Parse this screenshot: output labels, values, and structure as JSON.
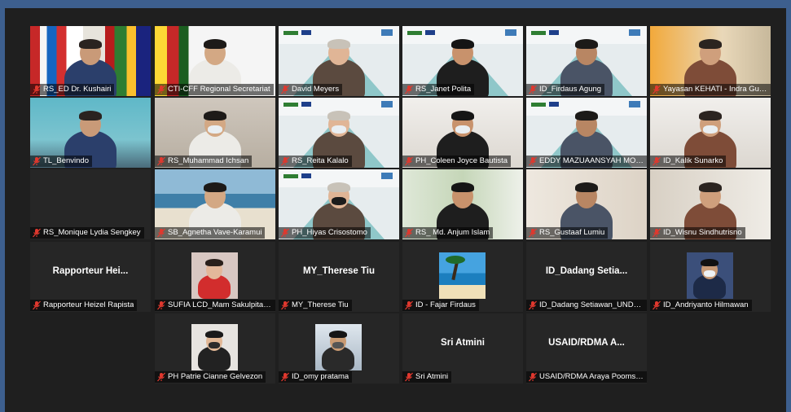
{
  "participants": [
    {
      "row": 0,
      "col": 0,
      "name": "RS_ED Dr. Kushairi",
      "type": "video",
      "bg": "flags"
    },
    {
      "row": 0,
      "col": 1,
      "name": "CTI-CFF Regional Secretariat",
      "type": "video",
      "bg": "flags2"
    },
    {
      "row": 0,
      "col": 2,
      "name": "David Meyers",
      "type": "video",
      "bg": "slide"
    },
    {
      "row": 0,
      "col": 3,
      "name": "RS_Janet Polita",
      "type": "video",
      "bg": "slide",
      "active": true
    },
    {
      "row": 0,
      "col": 4,
      "name": "ID_Firdaus Agung",
      "type": "video",
      "bg": "slide"
    },
    {
      "row": 0,
      "col": 5,
      "name": "Yayasan KEHATI - Indra Guna...",
      "type": "video",
      "bg": "warm"
    },
    {
      "row": 1,
      "col": 0,
      "name": "TL_Benvindo",
      "type": "video",
      "bg": "room"
    },
    {
      "row": 1,
      "col": 1,
      "name": "RS_Muhammad Ichsan",
      "type": "video",
      "bg": "wall"
    },
    {
      "row": 1,
      "col": 2,
      "name": "RS_Reita Kalalo",
      "type": "video",
      "bg": "slide"
    },
    {
      "row": 1,
      "col": 3,
      "name": "PH_Coleen Joyce Bautista",
      "type": "video",
      "bg": "light"
    },
    {
      "row": 1,
      "col": 4,
      "name": "EDDY MAZUAANSYAH MOHD...",
      "type": "video",
      "bg": "slide"
    },
    {
      "row": 1,
      "col": 5,
      "name": "ID_Kalik Sunarko",
      "type": "video",
      "bg": "light"
    },
    {
      "row": 2,
      "col": 0,
      "name": "RS_Monique Lydia Sengkey",
      "type": "blank"
    },
    {
      "row": 2,
      "col": 1,
      "name": "SB_Agnetha Vave-Karamui",
      "type": "video",
      "bg": "beach"
    },
    {
      "row": 2,
      "col": 2,
      "name": "PH_Hiyas Crisostomo",
      "type": "video",
      "bg": "slide"
    },
    {
      "row": 2,
      "col": 3,
      "name": "RS_ Md. Anjum Islam",
      "type": "video",
      "bg": "leaf"
    },
    {
      "row": 2,
      "col": 4,
      "name": "RS_Gustaaf Lumiu",
      "type": "video",
      "bg": "office"
    },
    {
      "row": 2,
      "col": 5,
      "name": "ID_Wisnu Sindhutrisno",
      "type": "video",
      "bg": "office2"
    },
    {
      "row": 3,
      "col": 0,
      "name": "Rapporteur Heizel Rapista",
      "type": "text",
      "display": "Rapporteur  Hei..."
    },
    {
      "row": 3,
      "col": 1,
      "name": "SUFIA LCD_Mam Sakulpitakph...",
      "type": "photo",
      "thumb": "woman-red"
    },
    {
      "row": 3,
      "col": 2,
      "name": "MY_Therese Tiu",
      "type": "text",
      "display": "MY_Therese Tiu"
    },
    {
      "row": 3,
      "col": 3,
      "name": "ID - Fajar Firdaus",
      "type": "photo",
      "thumb": "beach-photo"
    },
    {
      "row": 3,
      "col": 4,
      "name": "ID_Dadang Setiawan_UNDP A...",
      "type": "text",
      "display": "ID_Dadang  Setia..."
    },
    {
      "row": 3,
      "col": 5,
      "name": "ID_Andriyanto Hilmawan",
      "type": "photo",
      "thumb": "man-mask"
    },
    {
      "row": 4,
      "col": 1,
      "name": "PH Patrie Cianne Gelvezon",
      "type": "photo",
      "thumb": "woman-mask"
    },
    {
      "row": 4,
      "col": 2,
      "name": "ID_omy pratama",
      "type": "photo",
      "thumb": "camera-man"
    },
    {
      "row": 4,
      "col": 3,
      "name": "Sri Atmini",
      "type": "text",
      "display": "Sri Atmini"
    },
    {
      "row": 4,
      "col": 4,
      "name": "USAID/RDMA Araya Poomsari...",
      "type": "text",
      "display": "USAID/RDMA  A..."
    }
  ],
  "colors": {
    "muted_mic": "#e0382e",
    "active_border": "#b8d14a",
    "window_frame": "#3d5f8e",
    "tile_bg": "#262626"
  },
  "icons": {
    "mic": "muted-microphone-icon"
  }
}
